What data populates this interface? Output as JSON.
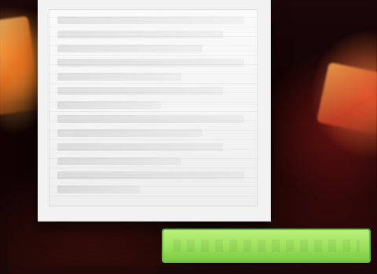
{
  "colors": {
    "dialog_bg": "#f2f2f2",
    "button_green": "#9be05a",
    "button_border": "#6bb83c"
  }
}
